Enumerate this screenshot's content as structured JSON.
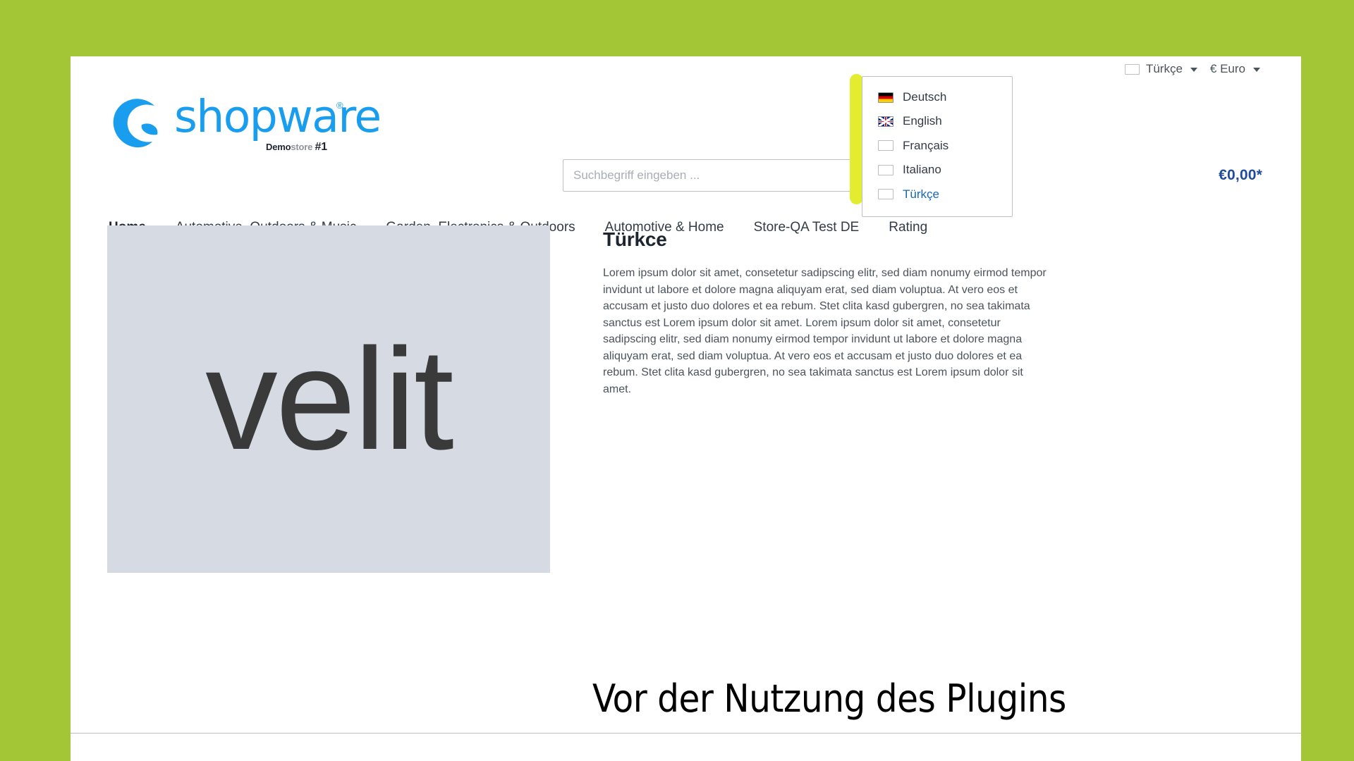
{
  "theme": {
    "background_color": "#a3c636",
    "brand_blue": "#199eef",
    "link_blue": "#1767b5",
    "price_blue": "#1f4b9e",
    "highlight_yellow": "#e3ec2e",
    "placeholder_grey": "#d6dbe3"
  },
  "top_bar": {
    "language": {
      "label": "Türkçe",
      "flag": "blank-flag-icon",
      "caret": "chevron-down-icon"
    },
    "currency": {
      "label": "€ Euro",
      "caret": "chevron-down-icon"
    }
  },
  "language_dropdown": {
    "open": true,
    "items": [
      {
        "label": "Deutsch",
        "flag": "german-flag-icon",
        "active": false
      },
      {
        "label": "English",
        "flag": "uk-flag-icon",
        "active": false
      },
      {
        "label": "Français",
        "flag": "blank-flag-icon",
        "active": false
      },
      {
        "label": "Italiano",
        "flag": "blank-flag-icon",
        "active": false
      },
      {
        "label": "Türkçe",
        "flag": "blank-flag-icon",
        "active": true
      }
    ]
  },
  "logo": {
    "wordmark": "shopware",
    "registered": "®",
    "tagline_demo": "Demo",
    "tagline_store": "store",
    "tagline_rank": "#1"
  },
  "search": {
    "placeholder": "Suchbegriff eingeben ...",
    "value": "",
    "icon": "search-icon"
  },
  "cart": {
    "price": "€0,00*"
  },
  "navigation": {
    "items": [
      {
        "label": "Home",
        "active": true
      },
      {
        "label": "Automotive, Outdoors & Music",
        "active": false
      },
      {
        "label": "Garden, Electronics & Outdoors",
        "active": false
      },
      {
        "label": "Automotive & Home",
        "active": false
      },
      {
        "label": "Store-QA Test DE",
        "active": false
      },
      {
        "label": "Rating",
        "active": false
      }
    ]
  },
  "product": {
    "image_placeholder_text": "velit",
    "title": "Türkce",
    "description": "Lorem ipsum dolor sit amet, consetetur sadipscing elitr, sed diam nonumy eirmod tempor invidunt ut labore et dolore magna aliquyam erat, sed diam voluptua. At vero eos et accusam et justo duo dolores et ea rebum. Stet clita kasd gubergren, no sea takimata sanctus est Lorem ipsum dolor sit amet. Lorem ipsum dolor sit amet, consetetur sadipscing elitr, sed diam nonumy eirmod tempor invidunt ut labore et dolore magna aliquyam erat, sed diam voluptua. At vero eos et accusam et justo duo dolores et ea rebum. Stet clita kasd gubergren, no sea takimata sanctus est Lorem ipsum dolor sit amet."
  },
  "caption": {
    "text": "Vor der Nutzung des Plugins"
  }
}
